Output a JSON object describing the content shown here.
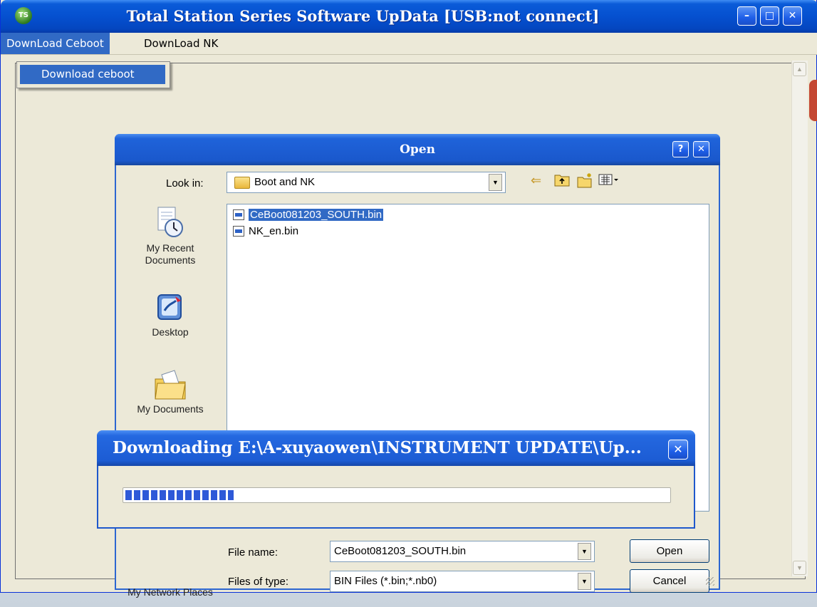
{
  "window": {
    "title": "Total Station Series Software UpData [USB:not connect]",
    "icon": "app-icon"
  },
  "menubar": {
    "items": [
      "DownLoad Ceboot",
      "DownLoad NK"
    ]
  },
  "dropdown": {
    "items": [
      "Download ceboot"
    ]
  },
  "open_dialog": {
    "title": "Open",
    "help_label": "?",
    "close_label": "✕",
    "look_in_label": "Look in:",
    "look_in_value": "Boot and NK",
    "places": [
      "My Recent Documents",
      "Desktop",
      "My Documents",
      "My Network Places"
    ],
    "files": [
      "CeBoot081203_SOUTH.bin",
      "NK_en.bin"
    ],
    "selected_file": "CeBoot081203_SOUTH.bin",
    "file_name_label": "File name:",
    "file_name_value": "CeBoot081203_SOUTH.bin",
    "files_of_type_label": "Files of type:",
    "files_of_type_value": "BIN Files (*.bin;*.nb0)",
    "open_button": "Open",
    "cancel_button": "Cancel"
  },
  "download_dialog": {
    "title": "Downloading E:\\A-xuyaowen\\INSTRUMENT UPDATE\\Up...",
    "close_label": "✕",
    "progress": 0.2
  },
  "colors": {
    "titlebar": "#0550d0",
    "selection": "#316ac5",
    "progress": "#2e59d8"
  }
}
